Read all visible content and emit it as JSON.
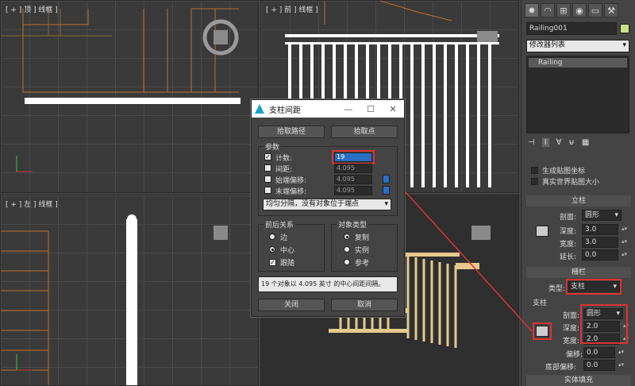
{
  "viewports": {
    "top_label": "[ + ] 顶 ] 线框 ]",
    "front_label": "[ + ] 前 ] 线框 ]",
    "left_label": "[ + ] 左 ] 线框 ]"
  },
  "panel": {
    "tab_icons": [
      "sun-icon",
      "modify-icon",
      "hierarchy-icon",
      "motion-icon",
      "display-icon",
      "utilities-icon"
    ],
    "object_name": "Railing001",
    "modifier_list": "修改器列表",
    "stack_item": "Railing",
    "gen_mapping": "生成贴图坐标",
    "real_world": "真实世界贴图大小",
    "posts_title": "立柱",
    "profile_label": "剖面:",
    "profile_value": "圆形",
    "depth_label": "深度:",
    "depth_value": "3.0",
    "width_label": "宽度:",
    "width_value": "3.0",
    "extension_label": "延长:",
    "extension_value": "0.0",
    "fencing_title": "栅栏",
    "type_label": "类型:",
    "type_value": "支柱",
    "pickets_group": "支柱",
    "pk_profile_label": "剖面:",
    "pk_profile_value": "圆形",
    "pk_depth_label": "深度:",
    "pk_depth_value": "2.0",
    "pk_width_label": "宽度:",
    "pk_width_value": "2.0",
    "bottom_label1": "偏移:",
    "bottom_value1": "0.0",
    "bottom_label2": "底部偏移:",
    "bottom_value2": "0.0",
    "solid_fill": "实体填充"
  },
  "dialog": {
    "title": "支柱间距",
    "pick_path": "拾取路径",
    "pick_points": "拾取点",
    "params_group": "参数",
    "count_label": "计数:",
    "count_value": "19",
    "spacing_label": "间距:",
    "spacing_value": "4.095",
    "start_offset_label": "始端偏移:",
    "start_offset_value": "4.095",
    "end_offset_label": "末端偏移:",
    "end_offset_value": "4.095",
    "distribution": "均匀分隔，没有对象位于端点",
    "context_group": "前后关系",
    "ctx_edge": "边",
    "ctx_center": "中心",
    "ctx_follow": "跟随",
    "type_group": "对象类型",
    "type_copy": "复制",
    "type_instance": "实例",
    "type_reference": "参考",
    "status_text": "19 个对象以 4.095 英寸 的中心间距间隔。",
    "close_label": "关闭",
    "cancel_label": "取消"
  },
  "colors": {
    "highlight": "#d33333",
    "selection": "#ffffff",
    "wood": "#e6c98e"
  }
}
